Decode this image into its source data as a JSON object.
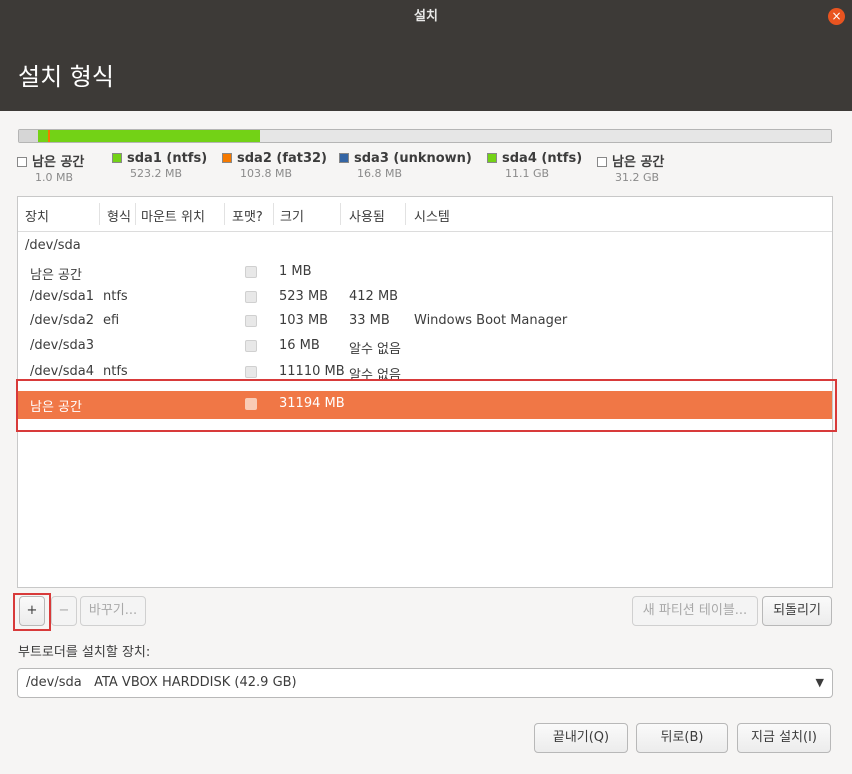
{
  "window": {
    "title": "설치",
    "close_symbol": "×"
  },
  "page_title": "설치 형식",
  "partition_bar": {
    "segments": [
      {
        "name": "free-space",
        "color": "#d6d6d6",
        "fraction": 0.0233
      },
      {
        "name": "sda1",
        "color": "#73d216",
        "fraction": 0.0122
      },
      {
        "name": "sda2",
        "color": "#f57900",
        "fraction": 0.0024
      },
      {
        "name": "sda3",
        "color": "#3465a4",
        "fraction": 0.0004
      },
      {
        "name": "sda4",
        "color": "#73d216",
        "fraction": 0.2588
      },
      {
        "name": "free-space",
        "color": "#e6e6e6",
        "fraction": 0.7029
      }
    ]
  },
  "legend": [
    {
      "label": "남은 공간",
      "size": "1.0 MB",
      "color": "#ffffff"
    },
    {
      "label": "sda1 (ntfs)",
      "size": "523.2 MB",
      "color": "#73d216"
    },
    {
      "label": "sda2 (fat32)",
      "size": "103.8 MB",
      "color": "#f57900"
    },
    {
      "label": "sda3 (unknown)",
      "size": "16.8 MB",
      "color": "#3465a4"
    },
    {
      "label": "sda4 (ntfs)",
      "size": "11.1 GB",
      "color": "#73d216"
    },
    {
      "label": "남은 공간",
      "size": "31.2 GB",
      "color": "#ffffff"
    }
  ],
  "table": {
    "headers": [
      "장치",
      "형식",
      "마운트 위치",
      "포맷?",
      "크기",
      "사용됨",
      "시스템"
    ],
    "rows": [
      {
        "device": "/dev/sda",
        "type": "",
        "mount": "",
        "format": false,
        "size": "",
        "used": "",
        "system": "",
        "has_checkbox": false
      },
      {
        "device": "남은 공간",
        "type": "",
        "mount": "",
        "format": false,
        "size": "1 MB",
        "used": "",
        "system": "",
        "has_checkbox": true
      },
      {
        "device": "/dev/sda1",
        "type": "ntfs",
        "mount": "",
        "format": false,
        "size": "523 MB",
        "used": "412 MB",
        "system": "",
        "has_checkbox": true
      },
      {
        "device": "/dev/sda2",
        "type": "efi",
        "mount": "",
        "format": false,
        "size": "103 MB",
        "used": "33 MB",
        "system": "Windows Boot Manager",
        "has_checkbox": true
      },
      {
        "device": "/dev/sda3",
        "type": "",
        "mount": "",
        "format": false,
        "size": "16 MB",
        "used": "알수 없음",
        "system": "",
        "has_checkbox": true
      },
      {
        "device": "/dev/sda4",
        "type": "ntfs",
        "mount": "",
        "format": false,
        "size": "11110 MB",
        "used": "알수 없음",
        "system": "",
        "has_checkbox": true
      },
      {
        "device": "남은 공간",
        "type": "",
        "mount": "",
        "format": false,
        "size": "31194 MB",
        "used": "",
        "system": "",
        "has_checkbox": true,
        "selected": true
      }
    ]
  },
  "buttons": {
    "add": "+",
    "remove": "−",
    "change": "바꾸기...",
    "new_table": "새 파티션 테이블...",
    "revert": "되돌리기"
  },
  "bootloader": {
    "label": "부트로더를 설치할 장치:",
    "selected": "/dev/sda   ATA VBOX HARDDISK (42.9 GB)",
    "arrow": "▼"
  },
  "footer": {
    "quit": "끝내기(Q)",
    "back": "뒤로(B)",
    "install": "지금 설치(I)"
  }
}
